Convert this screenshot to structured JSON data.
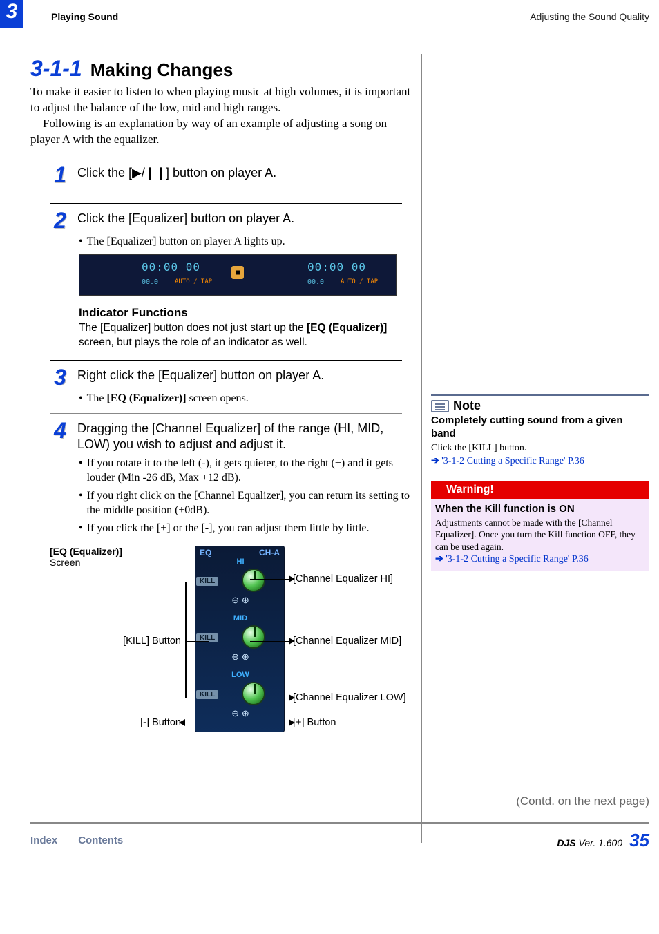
{
  "header": {
    "chapter_num": "3",
    "left": "Playing Sound",
    "right": "Adjusting the Sound Quality"
  },
  "section": {
    "number": "3-1-1",
    "title": "Making Changes",
    "intro_p1": "To make it easier to listen to when playing music at high volumes, it is important to adjust the balance of the low, mid and high ranges.",
    "intro_p2": "Following is an explanation by way of an example of adjusting a song on player A with the equalizer."
  },
  "steps": {
    "s1": {
      "num": "1",
      "text": "Click the [▶/❙❙] button on player A."
    },
    "s2": {
      "num": "2",
      "text": "Click the [Equalizer] button on player A.",
      "sub1": "The [Equalizer] button on player A lights up."
    },
    "indicator": {
      "title": "Indicator Functions",
      "body_pre": "The [Equalizer] button does not just start up the ",
      "body_bold": "[EQ (Equalizer)]",
      "body_post": " screen, but plays the role of an indicator as well."
    },
    "s3": {
      "num": "3",
      "text": "Right click the [Equalizer] button on player A.",
      "sub1_pre": "The ",
      "sub1_bold": "[EQ (Equalizer)]",
      "sub1_post": " screen opens."
    },
    "s4": {
      "num": "4",
      "text": "Dragging the [Channel Equalizer] of the range (HI, MID, LOW) you wish to adjust and adjust it.",
      "sub1": "If you rotate it to the left (-), it gets quieter, to the right (+) and it gets louder (Min -26 dB, Max +12 dB).",
      "sub2": "If you right click on the [Channel Equalizer], you can return its setting to the middle position (±0dB).",
      "sub3": "If you click the [+] or the [-], you can adjust them little by little."
    }
  },
  "diagram": {
    "screen_label_bold": "[EQ (Equalizer)]",
    "screen_label_rest": "Screen",
    "eq": "EQ",
    "ch": "CH-A",
    "hi": "HI",
    "mid": "MID",
    "low": "LOW",
    "kill": "KILL",
    "minus": "⊖",
    "plus": "⊕",
    "callout_hi": "[Channel Equalizer HI]",
    "callout_mid": "[Channel Equalizer MID]",
    "callout_low": "[Channel Equalizer LOW]",
    "callout_kill": "[KILL] Button",
    "callout_minus": "[-] Button",
    "callout_plus": "[+] Button"
  },
  "contd": "(Contd. on the next page)",
  "note": {
    "title": "Note",
    "subtitle": "Completely cutting sound from a given band",
    "body": "Click the [KILL] button.",
    "link": "'3-1-2 Cutting a Specific Range' P.36",
    "arrow": "➔"
  },
  "warning": {
    "header": "Warning!",
    "subtitle": "When the Kill function is ON",
    "body": "Adjustments cannot be made with the [Channel Equalizer]. Once you turn the Kill function OFF, they can be used again.",
    "link": "'3-1-2 Cutting a Specific Range' P.36",
    "arrow": "➔"
  },
  "footer": {
    "index": "Index",
    "contents": "Contents",
    "product": "DJS",
    "ver_label": " Ver. 1.600",
    "page": "35"
  }
}
